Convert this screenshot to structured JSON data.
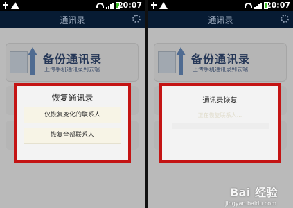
{
  "status_time": "20:07",
  "header": {
    "title": "通讯录"
  },
  "card": {
    "title": "备份通讯录",
    "subtitle": "上传手机通讯录到云端"
  },
  "left_dialog": {
    "title": "恢复通讯录",
    "options": [
      "仅恢复变化的联系人",
      "恢复全部联系人"
    ]
  },
  "right_dialog": {
    "title": "通讯录恢复",
    "message": "正在恢复联系人..."
  },
  "watermark": {
    "brand": "Bai 经验",
    "url": "jingyan.baidu.com"
  },
  "colors": {
    "dialog_border": "#c41414",
    "titlebar": "#071b33",
    "battery": "#3fbf2a"
  }
}
